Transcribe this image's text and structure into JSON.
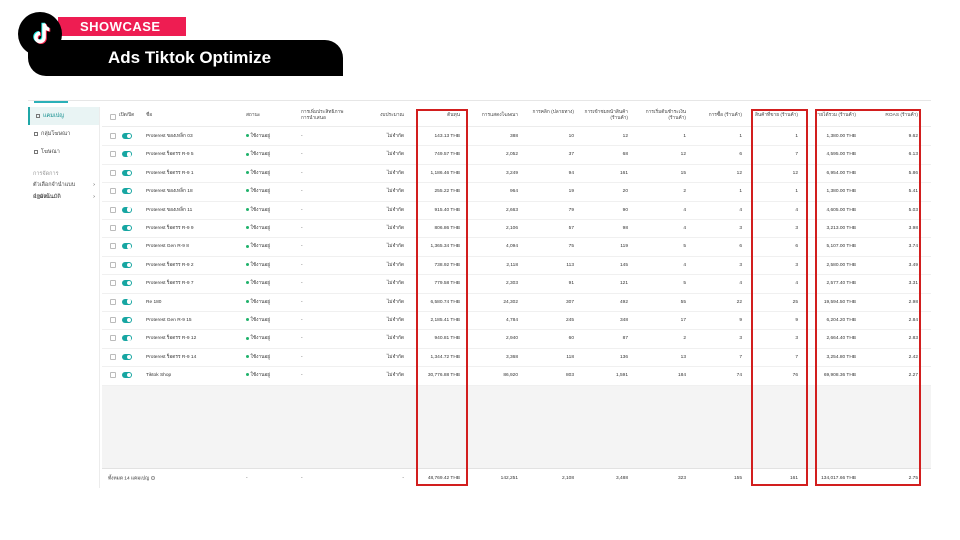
{
  "banner": {
    "logo_icon": "tiktok-logo-icon",
    "badge_label": "SHOWCASE",
    "title": "Ads Tiktok Optimize",
    "badge_color": "#ee1d52"
  },
  "sidebar": {
    "items": [
      {
        "label": "แคมเปญ",
        "active": true
      },
      {
        "label": "กลุ่มโฆษณา",
        "active": false
      },
      {
        "label": "โฆษณา",
        "active": false
      }
    ],
    "section_label": "การจัดการ",
    "sub_items": [
      {
        "label": "ตัวเลือกจำนำแบบจำนวน..."
      },
      {
        "label": "กฎอัตโนมัติ"
      }
    ]
  },
  "table": {
    "headers": {
      "toggle": "เปิด/ปิด",
      "name": "ชื่อ",
      "status": "สถานะ",
      "recommendation": "การเพิ่มประสิทธิภาพการนำเสนอ",
      "budget": "งบประมาณ",
      "cost": "ต้นทุน",
      "impressions": "การแสดงโฆษณา",
      "clicks": "การคลิก (ปลายทาง)",
      "add_to_cart": "การเข้าชมหน้าสินค้า (ร้านค้า)",
      "checkout": "การเริ่มต้นชำระเงิน (ร้านค้า)",
      "purchases": "การซื้อ (ร้านค้า)",
      "items_sold": "สินค้าที่ขาย (ร้านค้า)",
      "revenue": "รายได้รวม (ร้านค้า)",
      "roas": "ROAS (ร้านค้า)"
    },
    "status_text": "ใช้งานอยู่",
    "rec_text": "-",
    "budget_text": "ไม่จำกัด",
    "rows": [
      {
        "name": "Proterest ของเหล็ก 03",
        "cost": "143.13 THB",
        "impressions": "388",
        "clicks": "10",
        "views": "12",
        "checkout": "1",
        "purchases": "1",
        "items": "1",
        "revenue": "1,380.00 THB",
        "roas": "9.62"
      },
      {
        "name": "Proterest ร็อดรร R-9 5",
        "cost": "749.57 THB",
        "impressions": "2,052",
        "clicks": "37",
        "views": "68",
        "checkout": "12",
        "purchases": "6",
        "items": "7",
        "revenue": "4,595.00 THB",
        "roas": "6.13"
      },
      {
        "name": "Proterest ร็อดรร R-9 1",
        "cost": "1,186.46 THB",
        "impressions": "3,249",
        "clicks": "94",
        "views": "161",
        "checkout": "15",
        "purchases": "12",
        "items": "12",
        "revenue": "6,954.00 THB",
        "roas": "5.86"
      },
      {
        "name": "Proterest ของเหล็ก 18",
        "cost": "255.22 THB",
        "impressions": "964",
        "clicks": "19",
        "views": "20",
        "checkout": "2",
        "purchases": "1",
        "items": "1",
        "revenue": "1,380.00 THB",
        "roas": "5.41"
      },
      {
        "name": "Proterest ของเหล็ก 11",
        "cost": "915.40 THB",
        "impressions": "2,663",
        "clicks": "79",
        "views": "90",
        "checkout": "4",
        "purchases": "4",
        "items": "4",
        "revenue": "4,605.00 THB",
        "roas": "5.03"
      },
      {
        "name": "Proterest ร็อดรร R-9 9",
        "cost": "806.86 THB",
        "impressions": "2,106",
        "clicks": "57",
        "views": "98",
        "checkout": "4",
        "purchases": "3",
        "items": "3",
        "revenue": "3,213.00 THB",
        "roas": "3.98"
      },
      {
        "name": "Proterest Gen R-9 8",
        "cost": "1,365.34 THB",
        "impressions": "4,094",
        "clicks": "75",
        "views": "119",
        "checkout": "5",
        "purchases": "6",
        "items": "6",
        "revenue": "5,107.00 THB",
        "roas": "3.74"
      },
      {
        "name": "Proterest ร็อดรร R-9 2",
        "cost": "738.92 THB",
        "impressions": "2,118",
        "clicks": "113",
        "views": "145",
        "checkout": "4",
        "purchases": "3",
        "items": "3",
        "revenue": "2,580.00 THB",
        "roas": "3.49"
      },
      {
        "name": "Proterest ร็อดรร R-9 7",
        "cost": "779.58 THB",
        "impressions": "2,303",
        "clicks": "91",
        "views": "121",
        "checkout": "5",
        "purchases": "4",
        "items": "4",
        "revenue": "2,577.40 THB",
        "roas": "3.31"
      },
      {
        "name": "Re 180",
        "cost": "6,580.74 THB",
        "impressions": "24,302",
        "clicks": "307",
        "views": "492",
        "checkout": "55",
        "purchases": "22",
        "items": "25",
        "revenue": "19,594.50 THB",
        "roas": "2.98"
      },
      {
        "name": "Proterest Gen R-9 15",
        "cost": "2,185.41 THB",
        "impressions": "4,784",
        "clicks": "245",
        "views": "348",
        "checkout": "17",
        "purchases": "9",
        "items": "9",
        "revenue": "6,204.20 THB",
        "roas": "2.84"
      },
      {
        "name": "Proterest ร็อดรร R-9 12",
        "cost": "940.81 THB",
        "impressions": "2,940",
        "clicks": "60",
        "views": "87",
        "checkout": "2",
        "purchases": "3",
        "items": "3",
        "revenue": "2,664.40 THB",
        "roas": "2.83"
      },
      {
        "name": "Proterest ร็อดรร R-9 14",
        "cost": "1,344.72 THB",
        "impressions": "3,368",
        "clicks": "118",
        "views": "136",
        "checkout": "13",
        "purchases": "7",
        "items": "7",
        "revenue": "3,254.80 THB",
        "roas": "2.42"
      },
      {
        "name": "Tiktok Shop",
        "cost": "30,776.88 THB",
        "impressions": "86,920",
        "clicks": "803",
        "views": "1,591",
        "checkout": "184",
        "purchases": "74",
        "items": "76",
        "revenue": "69,908.36 THB",
        "roas": "2.27"
      }
    ],
    "footer": {
      "label": "ทั้งหมด 14 แคมเปญ",
      "status": "-",
      "rec": "-",
      "budget": "-",
      "cost": "48,769.42 THB",
      "impressions": "142,251",
      "clicks": "2,108",
      "views": "3,488",
      "checkout": "323",
      "purchases": "155",
      "items": "161",
      "revenue": "134,017.66 THB",
      "roas": "2.75"
    }
  },
  "colors": {
    "accent": "#17a6a2",
    "active_status": "#20b26b",
    "highlight": "#d21e1e"
  }
}
